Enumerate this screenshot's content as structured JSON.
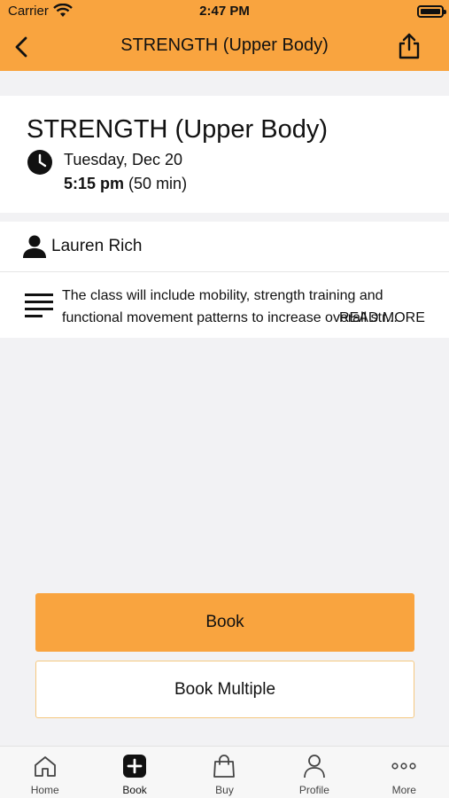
{
  "status_bar": {
    "carrier": "Carrier",
    "time": "2:47 PM"
  },
  "nav": {
    "title": "STRENGTH (Upper Body)",
    "back_icon": "chevron-left-icon",
    "share_icon": "share-icon"
  },
  "class": {
    "title": "STRENGTH (Upper Body)",
    "date": "Tuesday, Dec 20",
    "time": "5:15 pm",
    "duration": "(50 min)",
    "instructor": "Lauren Rich",
    "description": "The class will include mobility, strength training and functional movement patterns to increase overall str...",
    "read_more": "READ MORE"
  },
  "actions": {
    "book": "Book",
    "book_multiple": "Book Multiple"
  },
  "tabs": [
    {
      "label": "Home",
      "icon": "home-icon"
    },
    {
      "label": "Book",
      "icon": "plus-square-icon"
    },
    {
      "label": "Buy",
      "icon": "bag-icon"
    },
    {
      "label": "Profile",
      "icon": "person-icon"
    },
    {
      "label": "More",
      "icon": "more-dots-icon"
    }
  ],
  "colors": {
    "accent": "#f9a43f",
    "background": "#f2f2f4",
    "accent_border": "#f5c880"
  }
}
